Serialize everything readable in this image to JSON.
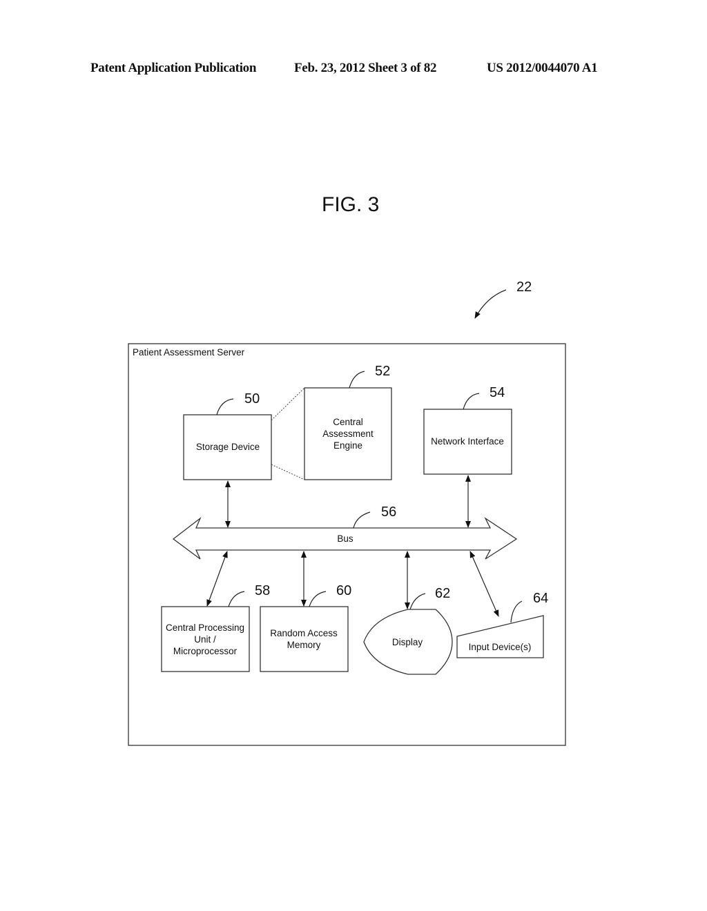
{
  "header": {
    "left": "Patent Application Publication",
    "date_sheet": "Feb. 23, 2012   Sheet 3 of 82",
    "pub_number": "US 2012/0044070 A1"
  },
  "figure": {
    "title": "FIG. 3",
    "system_ref": "22",
    "container_label": "Patient Assessment Server",
    "components": {
      "storage": {
        "ref": "50",
        "label": [
          "Storage Device"
        ]
      },
      "engine": {
        "ref": "52",
        "label": [
          "Central",
          "Assessment",
          "Engine"
        ]
      },
      "network": {
        "ref": "54",
        "label": [
          "Network Interface"
        ]
      },
      "bus": {
        "ref": "56",
        "label": [
          "Bus"
        ]
      },
      "cpu": {
        "ref": "58",
        "label": [
          "Central Processing",
          "Unit /",
          "Microprocessor"
        ]
      },
      "ram": {
        "ref": "60",
        "label": [
          "Random Access",
          "Memory"
        ]
      },
      "display": {
        "ref": "62",
        "label": [
          "Display"
        ]
      },
      "input": {
        "ref": "64",
        "label": [
          "Input Device(s)"
        ]
      }
    }
  }
}
